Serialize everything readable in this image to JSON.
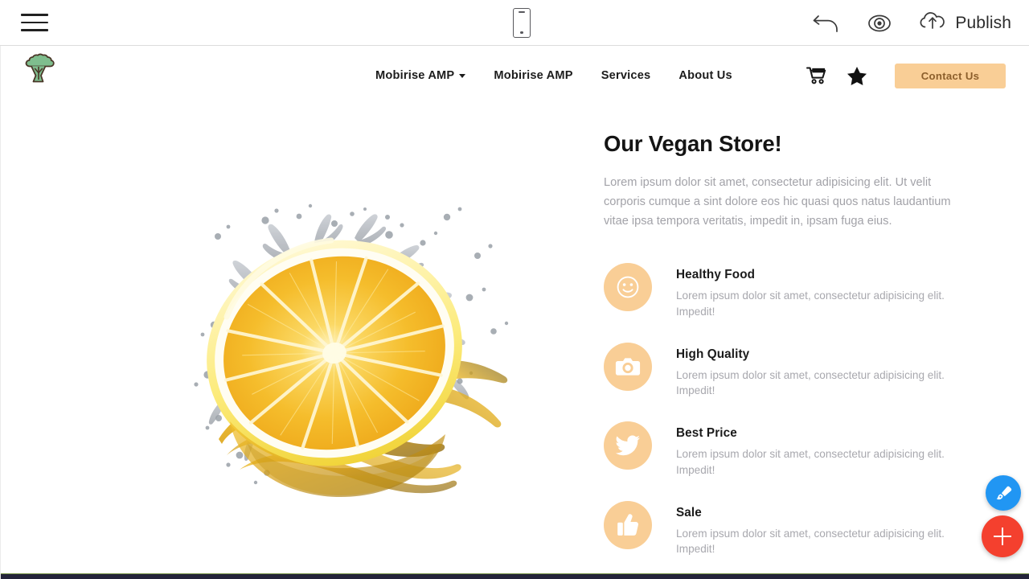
{
  "editor": {
    "menu_icon": "hamburger-menu-icon",
    "device_preview_icon": "mobile-device-icon",
    "undo_icon": "undo-arrow-icon",
    "preview_icon": "eye-preview-icon",
    "publish_icon": "cloud-upload-icon",
    "publish_label": "Publish"
  },
  "site": {
    "logo_icon": "broccoli-logo-icon",
    "nav": {
      "items": [
        {
          "label": "Mobirise AMP",
          "has_dropdown": true
        },
        {
          "label": "Mobirise AMP",
          "has_dropdown": false
        },
        {
          "label": "Services",
          "has_dropdown": false
        },
        {
          "label": "About Us",
          "has_dropdown": false
        }
      ],
      "cart_icon": "shopping-cart-icon",
      "star_icon": "star-icon",
      "contact_label": "Contact Us"
    },
    "hero": {
      "title": "Our Vegan Store!",
      "description": "Lorem ipsum dolor sit amet, consectetur adipisicing elit. Ut velit corporis cumque a sint dolore eos hic quasi quos natus laudantium vitae ipsa tempora veritatis, impedit in, ipsam fuga eius.",
      "image_alt": "lemon-slice-water-splash"
    },
    "features": [
      {
        "icon": "smiley-face-icon",
        "title": "Healthy Food",
        "description": "Lorem ipsum dolor sit amet, consectetur adipisicing elit. Impedit!"
      },
      {
        "icon": "camera-icon",
        "title": "High Quality",
        "description": "Lorem ipsum dolor sit amet, consectetur adipisicing elit. Impedit!"
      },
      {
        "icon": "twitter-bird-icon",
        "title": "Best Price",
        "description": "Lorem ipsum dolor sit amet, consectetur adipisicing elit. Impedit!"
      },
      {
        "icon": "thumbs-up-icon",
        "title": "Sale",
        "description": "Lorem ipsum dolor sit amet, consectetur adipisicing elit. Impedit!"
      }
    ]
  },
  "fabs": {
    "brush_icon": "paintbrush-icon",
    "add_icon": "plus-icon"
  },
  "colors": {
    "accent_peach": "#F9CE96",
    "accent_peach_text": "#8C5F2C",
    "logo_green": "#7FBE8E",
    "logo_outline": "#4A3728",
    "fab_blue": "#2196F3",
    "fab_red": "#F4402E",
    "heading": "#141414",
    "muted_text": "#A2A2A8",
    "bottom_strip": "#24243A",
    "green_rule": "#6E8B3D"
  }
}
